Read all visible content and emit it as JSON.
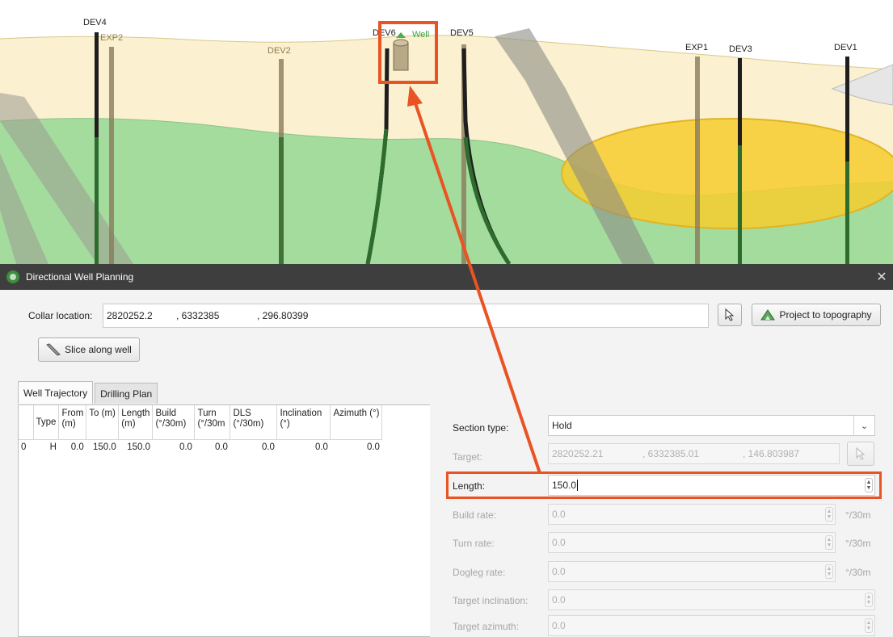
{
  "scene": {
    "well_labels": [
      "DEV4",
      "EXP2",
      "DEV2",
      "DEV6",
      "Well",
      "DEV5",
      "EXP1",
      "DEV3",
      "DEV1"
    ]
  },
  "dialog": {
    "title": "Directional Well Planning",
    "close_glyph": "✕",
    "collar": {
      "label": "Collar location:",
      "x": "2820252.2",
      "y": ", 6332385",
      "z": ", 296.80399"
    },
    "project_to_topography": "Project to topography",
    "slice_along_well": "Slice along well",
    "tabs": [
      "Well Trajectory",
      "Drilling Plan"
    ],
    "table": {
      "headers": [
        "",
        "Type",
        "From (m)",
        "To (m)",
        "Length (m)",
        "Build (°/30m)",
        "Turn (°/30m",
        "DLS (°/30m)",
        "Inclination (°)",
        "Azimuth (°)"
      ],
      "rows": [
        [
          "0",
          "H",
          "0.0",
          "150.0",
          "150.0",
          "0.0",
          "0.0",
          "0.0",
          "0.0",
          "0.0"
        ]
      ]
    },
    "form": {
      "section_type_label": "Section type:",
      "section_type_value": "Hold",
      "target_label": "Target:",
      "target_x": "2820252.21",
      "target_y": ", 6332385.01",
      "target_z": ", 146.803987",
      "length_label": "Length:",
      "length_value": "150.0",
      "build_rate_label": "Build rate:",
      "build_rate_value": "0.0",
      "turn_rate_label": "Turn rate:",
      "turn_rate_value": "0.0",
      "dogleg_rate_label": "Dogleg rate:",
      "dogleg_rate_value": "0.0",
      "target_inclination_label": "Target inclination:",
      "target_inclination_value": "0.0",
      "target_azimuth_label": "Target azimuth:",
      "target_azimuth_value": "0.0",
      "rate_unit": "°/30m"
    }
  },
  "colors": {
    "highlight": "#ea5323",
    "titlebar": "#3e3e3e",
    "layer_top": "#fbf3d8",
    "layer_green": "#9fd89a",
    "ore_body": "#f5cf3a"
  }
}
